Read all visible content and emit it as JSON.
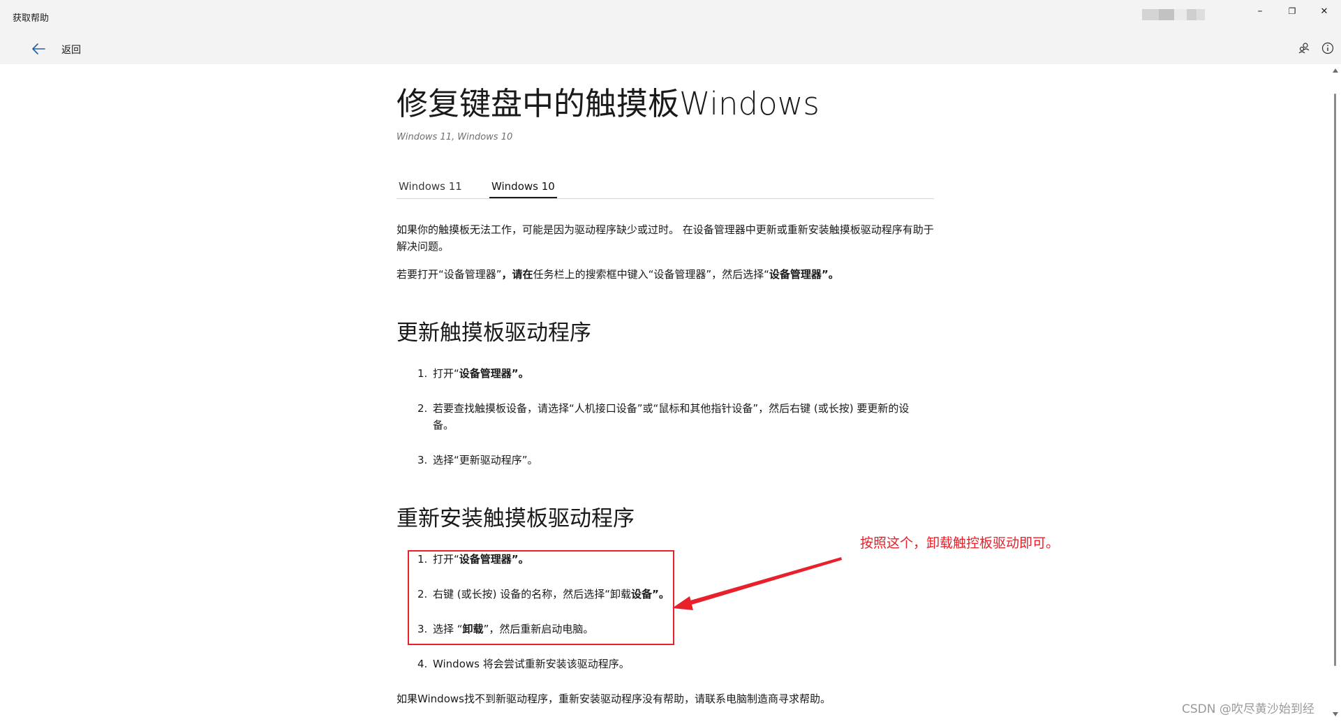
{
  "window": {
    "app_title": "获取帮助",
    "minimize_glyph": "–",
    "restore_glyph": "❐",
    "close_glyph": "✕"
  },
  "nav": {
    "back_label": "返回",
    "icons": [
      "back-arrow-icon",
      "share-icon",
      "info-icon"
    ]
  },
  "article": {
    "title": "修复键盘中的触摸板Windows",
    "applies_to": "Windows 11, Windows 10",
    "tabs": [
      {
        "label": "Windows 11",
        "active": false
      },
      {
        "label": "Windows 10",
        "active": true
      }
    ],
    "intro": "如果你的触摸板无法工作，可能是因为驱动程序缺少或过时。 在设备管理器中更新或重新安装触摸板驱动程序有助于解决问题。",
    "open_instruction": {
      "p1": "若要打开“设备管理器”",
      "p2": "，请在",
      "p3": "任务栏上的搜索框中键入“设备管理器”，然后选择“",
      "p4": "设备管理器",
      "p5": "”。"
    },
    "section1": {
      "heading": "更新触摸板驱动程序",
      "steps": [
        {
          "num": "1.",
          "pre": "打开“",
          "bold": "设备管理器",
          "post": "”。"
        },
        {
          "num": "2.",
          "text": "若要查找触摸板设备，请选择“人机接口设备”或“鼠标和其他指针设备”，然后右键 (或长按) 要更新的设备。"
        },
        {
          "num": "3.",
          "text": "选择“更新驱动程序”。"
        }
      ]
    },
    "section2": {
      "heading": "重新安装触摸板驱动程序",
      "steps": [
        {
          "num": "1.",
          "pre": "打开“",
          "bold": "设备管理器",
          "post": "”。"
        },
        {
          "num": "2.",
          "pre": "右键 (或长按) 设备的名称，然后选择“卸载",
          "bold": "设备",
          "post": "”。"
        },
        {
          "num": "3.",
          "pre": "选择 “",
          "bold": "卸载",
          "post": "”，然后重新启动电脑。"
        },
        {
          "num": "4.",
          "text": "Windows 将会尝试重新安装该驱动程序。"
        }
      ]
    },
    "footer_note": "如果Windows找不到新驱动程序，重新安装驱动程序没有帮助，请联系电脑制造商寻求帮助。"
  },
  "annotation": {
    "text": "按照这个，卸载触控板驱动即可。",
    "color": "#e8202a"
  },
  "watermark": "CSDN @吹尽黄沙始到经"
}
